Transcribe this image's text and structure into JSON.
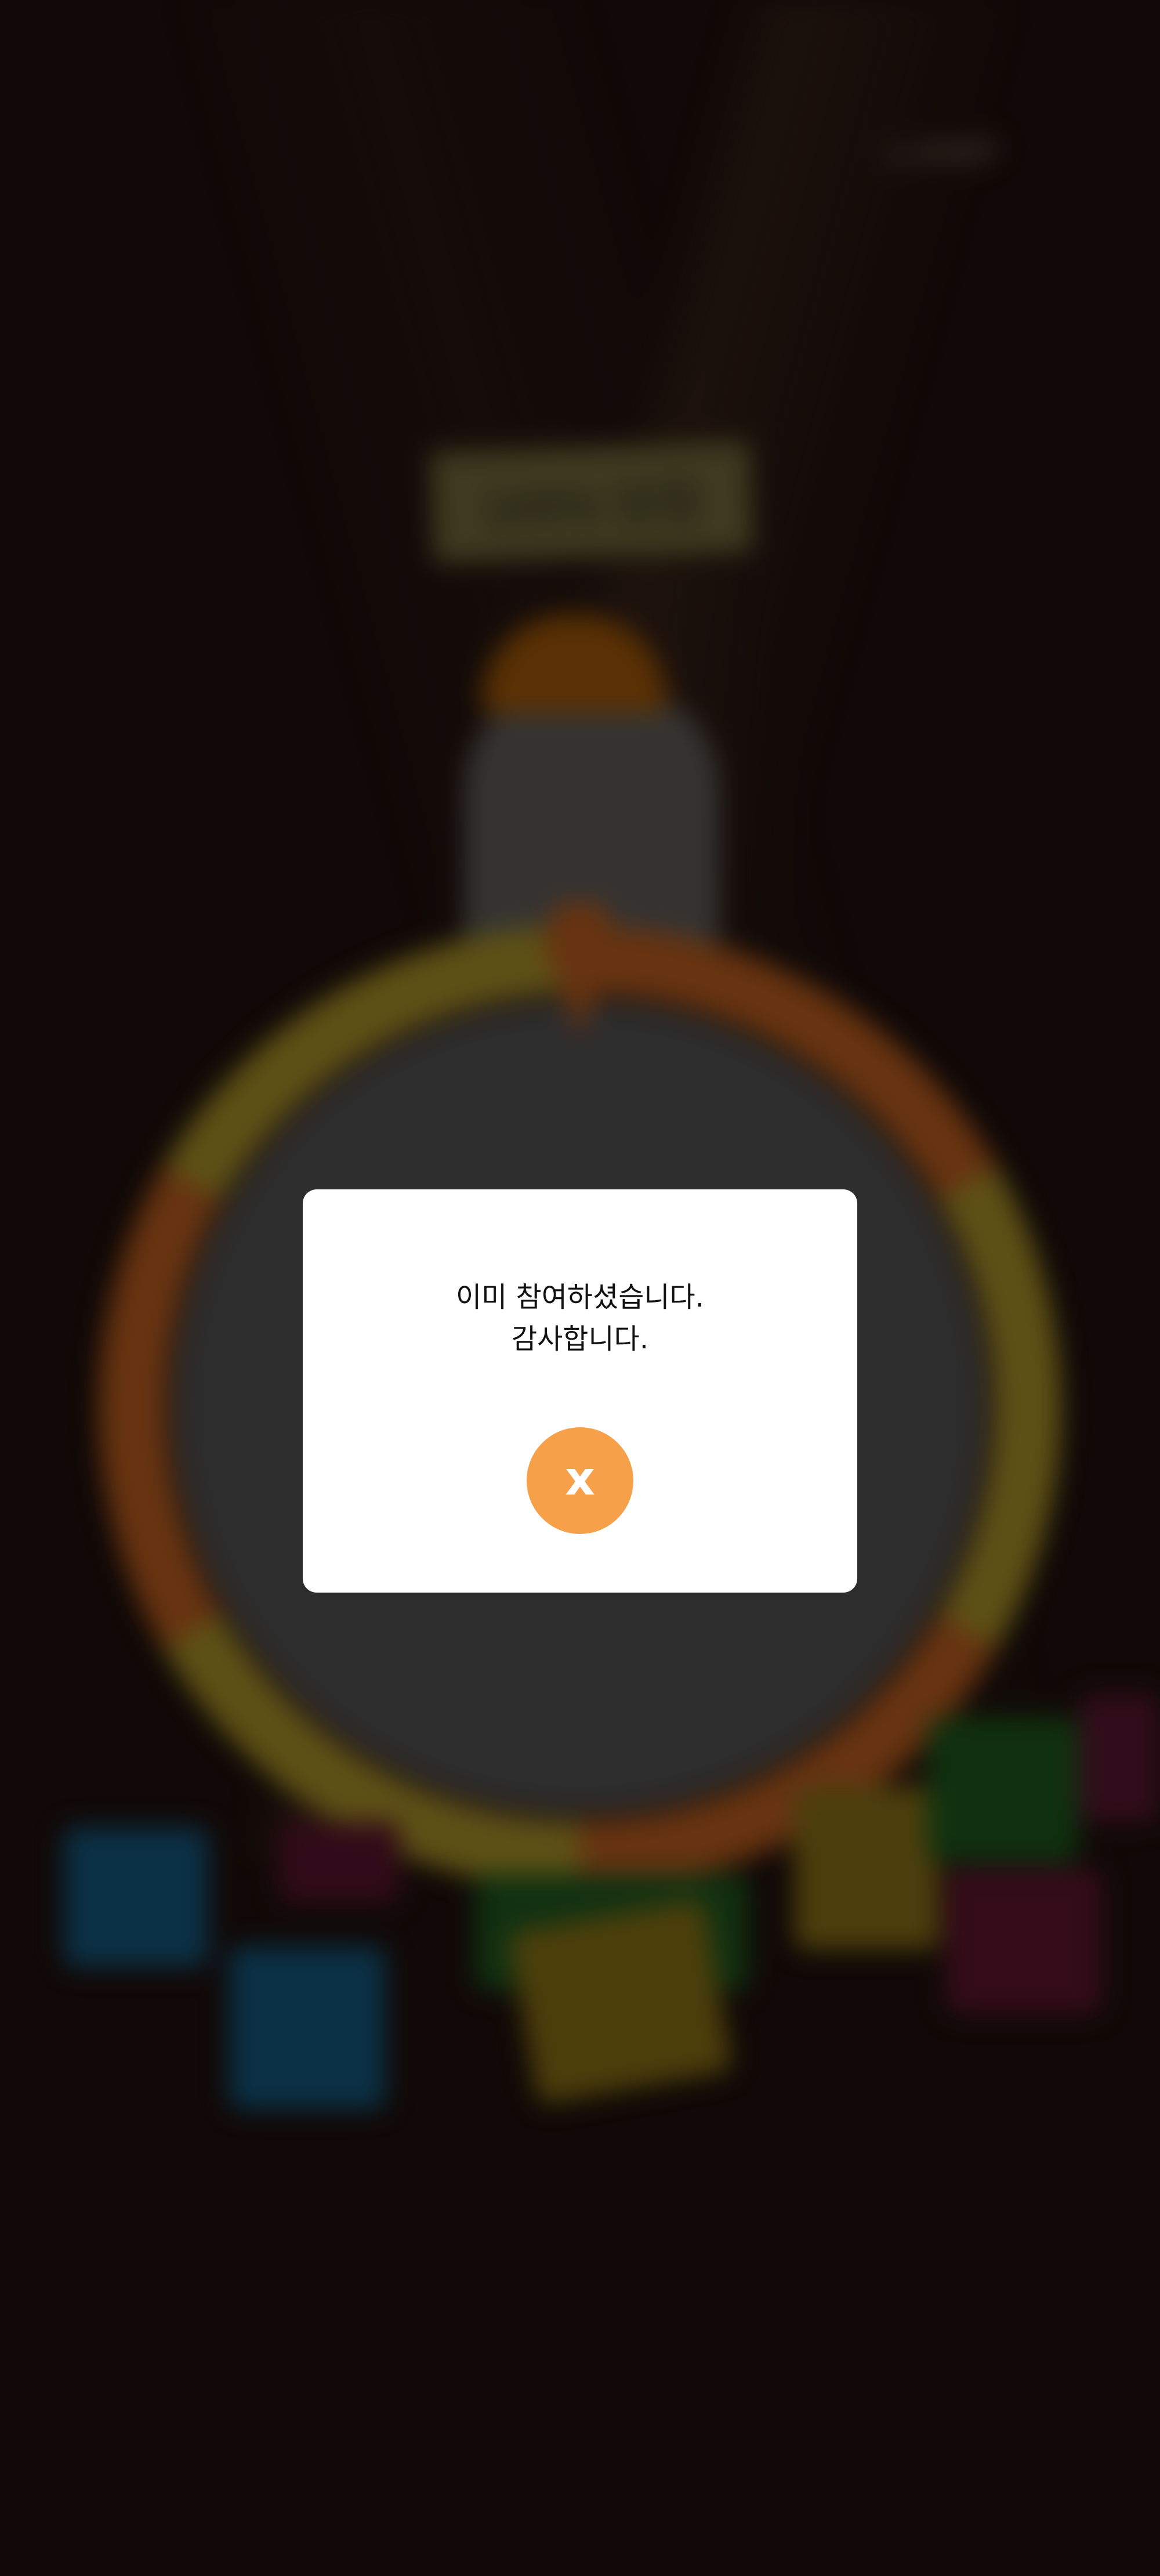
{
  "background": {
    "brand_logo": "LAMP",
    "event_banner": "100% 당첨"
  },
  "modal": {
    "message_line1": "이미 참여하셨습니다.",
    "message_line2": "감사합니다.",
    "close_label": "x",
    "close_button_color": "#F6A04A"
  }
}
